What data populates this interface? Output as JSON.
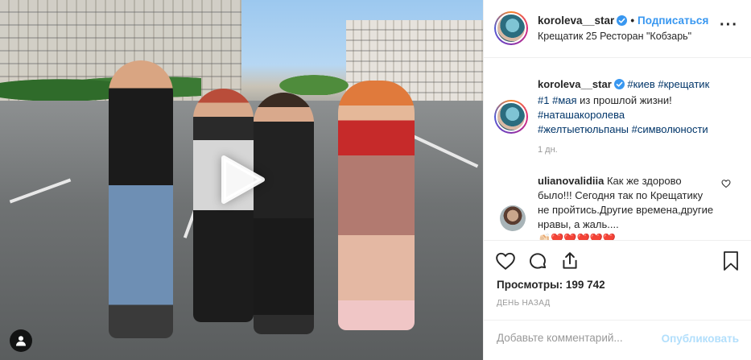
{
  "post": {
    "username": "koroleva__star",
    "follow_label": "Подписаться",
    "location": "Крещатик 25 Ресторан \"Кобзарь\""
  },
  "caption": {
    "username": "koroleva__star",
    "tags_line1": "#киев #крещатик",
    "tag_1": "#1",
    "tag_may": "#мая",
    "text": " из прошлой жизни!",
    "tags_line3": "#наташакоролева",
    "tags_line4": "#желтыетюльпаны #символюности",
    "time": "1 дн."
  },
  "comment": {
    "username": "ulianovalidiia",
    "text": "Как же здорово было!!! Сегодня так по Крещатику не пройтись.Другие времена,другие нравы, а жаль....",
    "overflow_line": "👏🏻❤️❤️❤️❤️❤️"
  },
  "stats": {
    "views": "Просмотры: 199 742",
    "date": "ДЕНЬ НАЗАД"
  },
  "add_comment": {
    "placeholder": "Добавьте комментарий...",
    "publish_label": "Опубликовать"
  },
  "icons": {
    "verified": "verified-badge-icon",
    "more": "more-options-icon",
    "like": "heart-icon",
    "comment": "comment-icon",
    "share": "share-icon",
    "save": "bookmark-icon",
    "play": "play-icon",
    "tag": "user-tag-icon"
  },
  "colors": {
    "link": "#3897f0",
    "hashtag": "#003569",
    "muted": "#999999",
    "publish_disabled": "#b2dffc"
  }
}
